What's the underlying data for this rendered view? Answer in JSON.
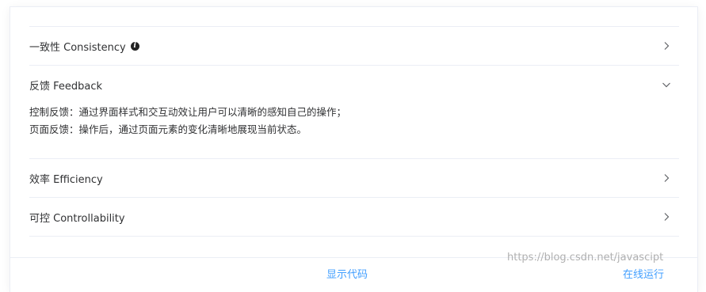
{
  "collapse": {
    "items": [
      {
        "label": "一致性 Consistency",
        "expanded": false,
        "has_info": true,
        "icon": "chevron-right-icon"
      },
      {
        "label": "反馈 Feedback",
        "expanded": true,
        "icon": "chevron-down-icon",
        "content": [
          "控制反馈：通过界面样式和交互动效让用户可以清晰的感知自己的操作；",
          "页面反馈：操作后，通过页面元素的变化清晰地展现当前状态。"
        ]
      },
      {
        "label": "效率 Efficiency",
        "expanded": false,
        "icon": "chevron-right-icon"
      },
      {
        "label": "可控 Controllability",
        "expanded": false,
        "icon": "chevron-right-icon"
      }
    ],
    "info_icon_text": "i"
  },
  "footer": {
    "left_link": "显示代码",
    "right_link": "在线运行"
  },
  "watermark": "https://blog.csdn.net/javascipt",
  "colors": {
    "text": "#303133",
    "border": "#ebeef5",
    "link": "#409eff"
  }
}
